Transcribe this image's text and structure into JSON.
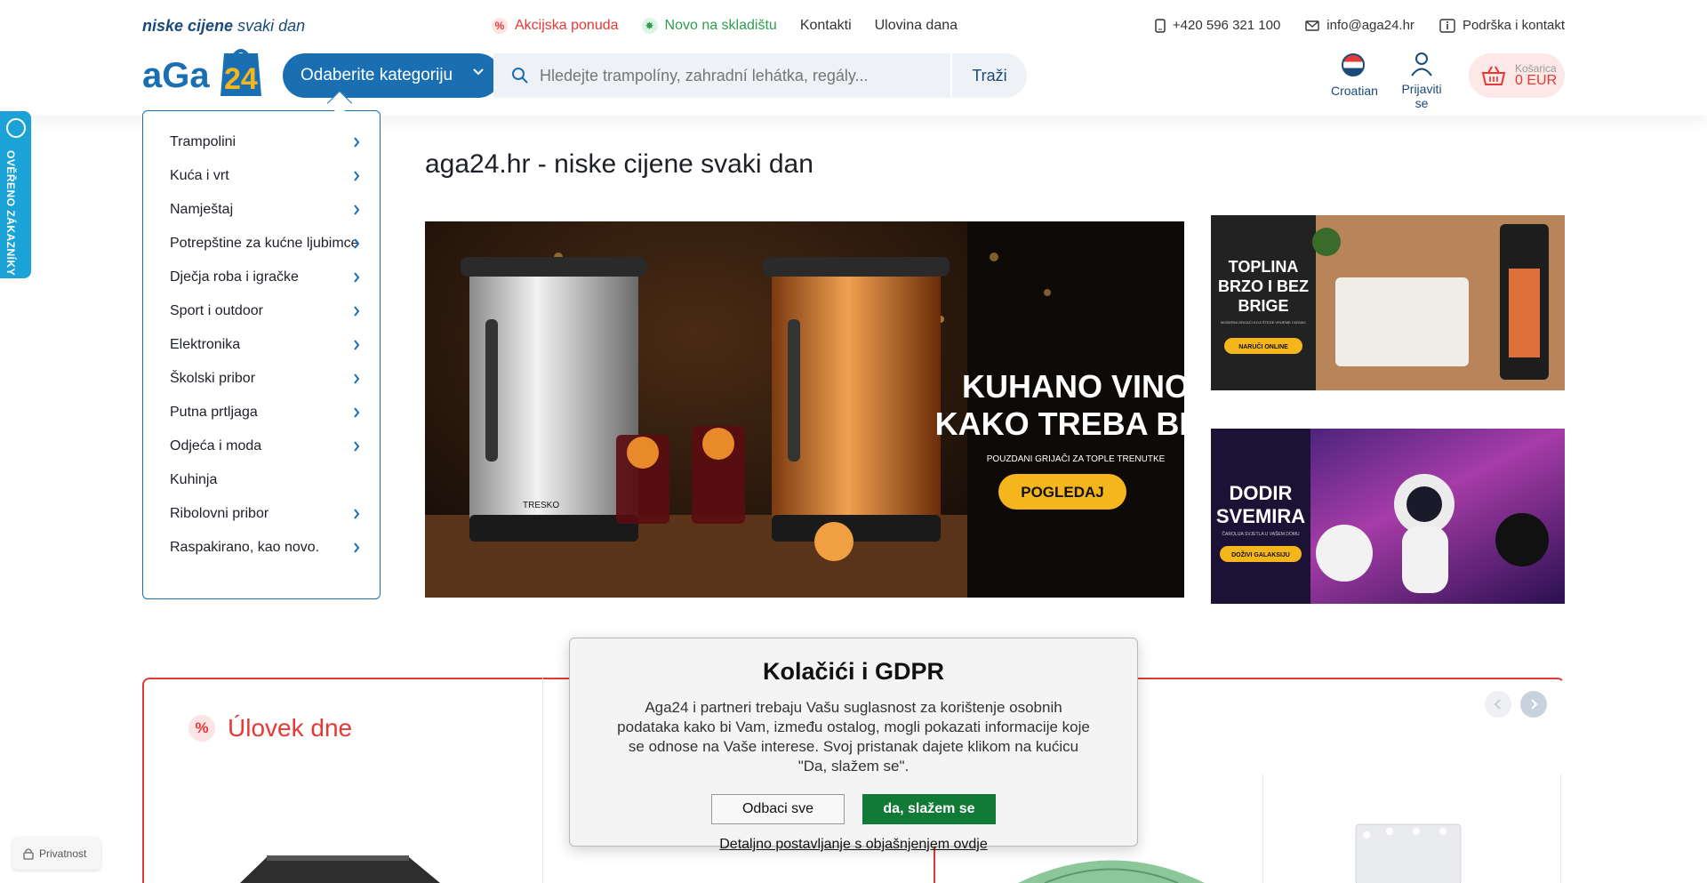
{
  "header": {
    "tagline_bold": "niske cijene",
    "tagline_rest": " svaki dan",
    "logo_text": "aGa24",
    "nav": [
      {
        "label": "Akcijska ponuda",
        "icon": "percent-icon"
      },
      {
        "label": "Novo na skladištu",
        "icon": "star-icon"
      },
      {
        "label": "Kontakti"
      },
      {
        "label": "Ulovina dana"
      }
    ],
    "phone": "+420 596 321 100",
    "email": "info@aga24.hr",
    "support": "Podrška i kontakt",
    "category_button": "Odaberite kategoriju",
    "search_placeholder": "Hledejte trampolíny, zahradní lehátka, regály...",
    "search_button": "Traži",
    "language": "Croatian",
    "login": "Prijaviti se",
    "cart_label": "Košarica",
    "cart_total": "0 EUR"
  },
  "verified_badge": "OVĚŘENO ZÁKAZNÍKY",
  "categories": [
    {
      "label": "Trampolini",
      "has_sub": true
    },
    {
      "label": "Kuća i vrt",
      "has_sub": true
    },
    {
      "label": "Namještaj",
      "has_sub": true
    },
    {
      "label": "Potrepštine za kućne ljubimce",
      "has_sub": true
    },
    {
      "label": "Dječja roba i igračke",
      "has_sub": true
    },
    {
      "label": "Sport i outdoor",
      "has_sub": true
    },
    {
      "label": "Elektronika",
      "has_sub": true
    },
    {
      "label": "Školski pribor",
      "has_sub": true
    },
    {
      "label": "Putna prtljaga",
      "has_sub": true
    },
    {
      "label": "Odjeća i moda",
      "has_sub": true
    },
    {
      "label": "Kuhinja",
      "has_sub": false
    },
    {
      "label": "Ribolovni pribor",
      "has_sub": true
    },
    {
      "label": "Raspakirano, kao novo.",
      "has_sub": true
    }
  ],
  "main": {
    "title": "aga24.hr - niske cijene svaki dan",
    "hero": {
      "headline1": "KUHANO VINO",
      "headline2": "KAKO TREBA BITI",
      "sub": "POUZDANI GRIJAČI ZA TOPLE TRENUTKE",
      "cta": "POGLEDAJ",
      "brand": "TRESKO"
    },
    "banner1": {
      "line1": "TOPLINA",
      "line2": "BRZO I BEZ",
      "line3": "BRIGE",
      "sub": "MODERNI GRIJAĆI KOJI ŠTEDE VRIJEME I NOVAC",
      "cta": "NARUČI ONLINE"
    },
    "banner2": {
      "line1": "DODIR",
      "line2": "SVEMIRA",
      "sub": "ČAROLIJA SVJETLA U VAŠEM DOMU",
      "cta": "DOŽIVI GALAKSIJU"
    }
  },
  "deal": {
    "title": "Úlovek dne"
  },
  "cookie": {
    "title": "Kolačići i GDPR",
    "text": "Aga24 i partneri trebaju Vašu suglasnost za korištenje osobnih podataka kako bi Vam, između ostalog, mogli pokazati informacije koje se odnose na Vaše interese. Svoj pristanak dajete klikom na kućicu \"Da, slažem se\".",
    "decline": "Odbaci sve",
    "accept": "da, slažem se",
    "details": "Detaljno postavljanje s objašnjenjem ovdje"
  },
  "privacy": "Privatnost",
  "colors": {
    "brand_blue": "#1a6fb3",
    "accent_red": "#e53935",
    "accept_green": "#117a36",
    "hero_yellow": "#f5b51c"
  }
}
